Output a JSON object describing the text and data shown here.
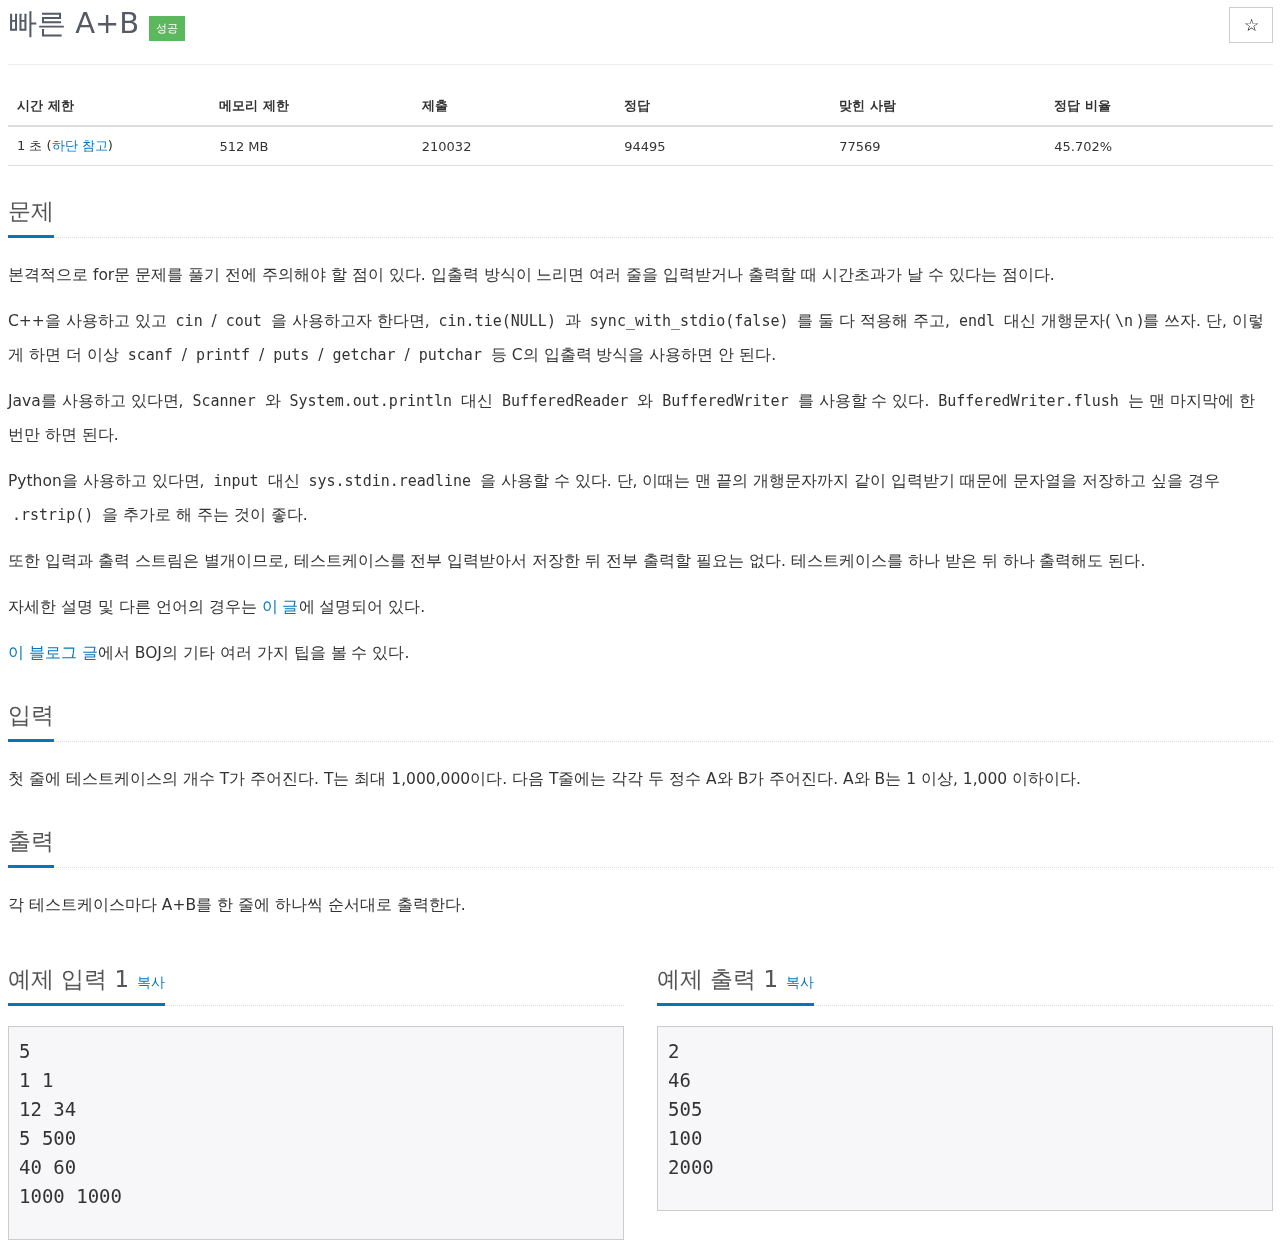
{
  "title": "빠른 A+B",
  "badge": "성공",
  "star_button": "☆",
  "stats": {
    "columns": [
      "시간 제한",
      "메모리 제한",
      "제출",
      "정답",
      "맞힌 사람",
      "정답 비율"
    ],
    "cells": [
      [
        {
          "kind": "text",
          "text": "1 초 ("
        },
        {
          "kind": "link",
          "text": "하단 참고"
        },
        {
          "kind": "text",
          "text": ")"
        }
      ],
      [
        {
          "kind": "text",
          "text": "512 MB"
        }
      ],
      [
        {
          "kind": "text",
          "text": "210032"
        }
      ],
      [
        {
          "kind": "text",
          "text": "94495"
        }
      ],
      [
        {
          "kind": "text",
          "text": "77569"
        }
      ],
      [
        {
          "kind": "text",
          "text": "45.702%"
        }
      ]
    ]
  },
  "sections": [
    {
      "heading": "문제",
      "paragraphs": [
        [
          {
            "kind": "text",
            "text": "본격적으로 for문 문제를 풀기 전에 주의해야 할 점이 있다. 입출력 방식이 느리면 여러 줄을 입력받거나 출력할 때 시간초과가 날 수 있다는 점이다."
          }
        ],
        [
          {
            "kind": "text",
            "text": "C++을 사용하고 있고 "
          },
          {
            "kind": "code",
            "text": "cin"
          },
          {
            "kind": "text",
            "text": " / "
          },
          {
            "kind": "code",
            "text": "cout"
          },
          {
            "kind": "text",
            "text": " 을 사용하고자 한다면, "
          },
          {
            "kind": "code",
            "text": "cin.tie(NULL)"
          },
          {
            "kind": "text",
            "text": " 과 "
          },
          {
            "kind": "code",
            "text": "sync_with_stdio(false)"
          },
          {
            "kind": "text",
            "text": " 를 둘 다 적용해 주고, "
          },
          {
            "kind": "code",
            "text": "endl"
          },
          {
            "kind": "text",
            "text": " 대신 개행문자("
          },
          {
            "kind": "code",
            "text": "\\n"
          },
          {
            "kind": "text",
            "text": ")를 쓰자. 단, 이렇게 하면 더 이상 "
          },
          {
            "kind": "code",
            "text": "scanf"
          },
          {
            "kind": "text",
            "text": " / "
          },
          {
            "kind": "code",
            "text": "printf"
          },
          {
            "kind": "text",
            "text": " / "
          },
          {
            "kind": "code",
            "text": "puts"
          },
          {
            "kind": "text",
            "text": " / "
          },
          {
            "kind": "code",
            "text": "getchar"
          },
          {
            "kind": "text",
            "text": " / "
          },
          {
            "kind": "code",
            "text": "putchar"
          },
          {
            "kind": "text",
            "text": " 등 C의 입출력 방식을 사용하면 안 된다."
          }
        ],
        [
          {
            "kind": "text",
            "text": "Java를 사용하고 있다면, "
          },
          {
            "kind": "code",
            "text": "Scanner"
          },
          {
            "kind": "text",
            "text": " 와 "
          },
          {
            "kind": "code",
            "text": "System.out.println"
          },
          {
            "kind": "text",
            "text": " 대신 "
          },
          {
            "kind": "code",
            "text": "BufferedReader"
          },
          {
            "kind": "text",
            "text": " 와 "
          },
          {
            "kind": "code",
            "text": "BufferedWriter"
          },
          {
            "kind": "text",
            "text": " 를 사용할 수 있다. "
          },
          {
            "kind": "code",
            "text": "BufferedWriter.flush"
          },
          {
            "kind": "text",
            "text": " 는 맨 마지막에 한 번만 하면 된다."
          }
        ],
        [
          {
            "kind": "text",
            "text": "Python을 사용하고 있다면, "
          },
          {
            "kind": "code",
            "text": "input"
          },
          {
            "kind": "text",
            "text": " 대신 "
          },
          {
            "kind": "code",
            "text": "sys.stdin.readline"
          },
          {
            "kind": "text",
            "text": " 을 사용할 수 있다. 단, 이때는 맨 끝의 개행문자까지 같이 입력받기 때문에 문자열을 저장하고 싶을 경우 "
          },
          {
            "kind": "code",
            "text": ".rstrip()"
          },
          {
            "kind": "text",
            "text": " 을 추가로 해 주는 것이 좋다."
          }
        ],
        [
          {
            "kind": "text",
            "text": "또한 입력과 출력 스트림은 별개이므로, 테스트케이스를 전부 입력받아서 저장한 뒤 전부 출력할 필요는 없다. 테스트케이스를 하나 받은 뒤 하나 출력해도 된다."
          }
        ],
        [
          {
            "kind": "text",
            "text": "자세한 설명 및 다른 언어의 경우는 "
          },
          {
            "kind": "link",
            "text": "이 글"
          },
          {
            "kind": "text",
            "text": "에 설명되어 있다."
          }
        ],
        [
          {
            "kind": "link",
            "text": "이 블로그 글"
          },
          {
            "kind": "text",
            "text": "에서 BOJ의 기타 여러 가지 팁을 볼 수 있다."
          }
        ]
      ]
    },
    {
      "heading": "입력",
      "paragraphs": [
        [
          {
            "kind": "text",
            "text": "첫 줄에 테스트케이스의 개수 T가 주어진다. T는 최대 1,000,000이다. 다음 T줄에는 각각 두 정수 A와 B가 주어진다. A와 B는 1 이상, 1,000 이하이다."
          }
        ]
      ]
    },
    {
      "heading": "출력",
      "paragraphs": [
        [
          {
            "kind": "text",
            "text": "각 테스트케이스마다 A+B를 한 줄에 하나씩 순서대로 출력한다."
          }
        ]
      ]
    }
  ],
  "samples": [
    {
      "heading": "예제 입력 1",
      "copy": "복사",
      "lines": [
        "5",
        "1 1",
        "12 34",
        "5 500",
        "40 60",
        "1000 1000"
      ]
    },
    {
      "heading": "예제 출력 1",
      "copy": "복사",
      "lines": [
        "2",
        "46",
        "505",
        "100",
        "2000"
      ]
    }
  ]
}
